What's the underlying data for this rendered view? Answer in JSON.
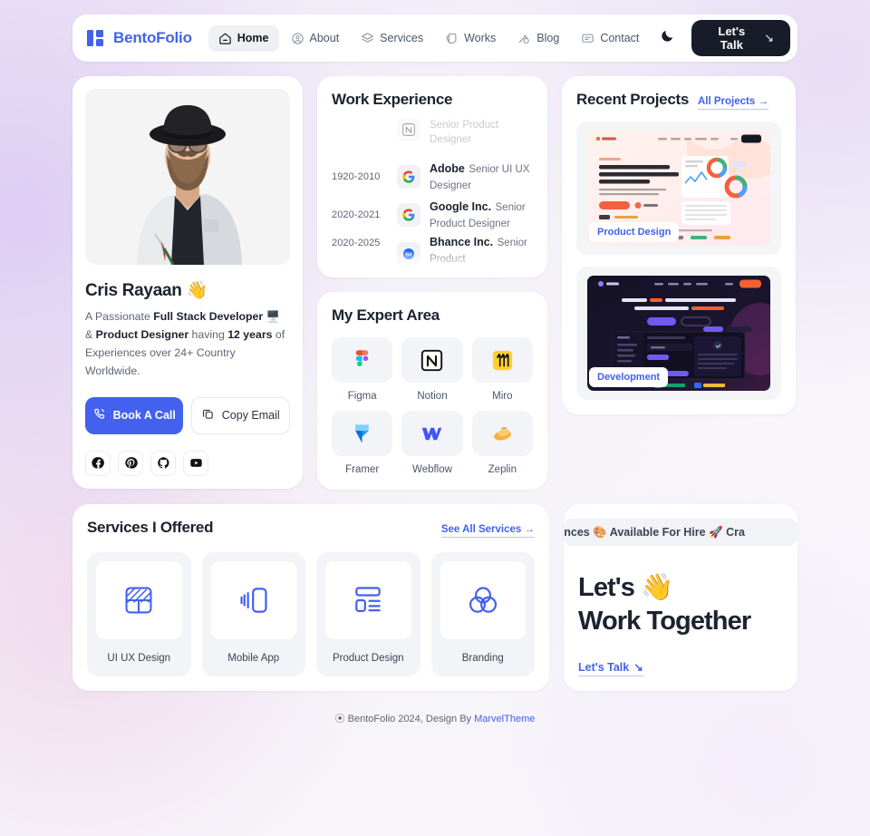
{
  "brand": {
    "name": "BentoFolio",
    "logo_icon": "bento-squares-logo",
    "color": "#4361ee"
  },
  "nav": {
    "items": [
      {
        "label": "Home",
        "icon": "home-icon",
        "active": true
      },
      {
        "label": "About",
        "icon": "user-circle-icon",
        "active": false
      },
      {
        "label": "Services",
        "icon": "layers-icon",
        "active": false
      },
      {
        "label": "Works",
        "icon": "cards-icon",
        "active": false
      },
      {
        "label": "Blog",
        "icon": "pen-icon",
        "active": false
      },
      {
        "label": "Contact",
        "icon": "message-icon",
        "active": false
      }
    ],
    "theme_toggle_icon": "moon-icon",
    "cta_label": "Let's Talk",
    "cta_arrow": "↘"
  },
  "profile": {
    "photo_alt": "portrait-photo",
    "name": "Cris Rayaan",
    "name_emoji": "👋",
    "bio_parts": [
      {
        "text": "A Passionate ",
        "bold": false
      },
      {
        "text": "Full Stack Developer",
        "bold": true
      },
      {
        "text": " 🖥️ & ",
        "bold": false
      },
      {
        "text": "Product Designer",
        "bold": true
      },
      {
        "text": " having ",
        "bold": false
      },
      {
        "text": "12 years",
        "bold": true
      },
      {
        "text": " of Experiences over 24+ Country Worldwide.",
        "bold": false
      }
    ],
    "primary_button": {
      "label": "Book A Call",
      "icon": "phone-ring-icon",
      "color": "#4361ee"
    },
    "secondary_button": {
      "label": "Copy Email",
      "icon": "copy-icon"
    },
    "socials": [
      {
        "name": "facebook-icon"
      },
      {
        "name": "pinterest-icon"
      },
      {
        "name": "github-icon"
      },
      {
        "name": "youtube-icon"
      }
    ]
  },
  "work_experience": {
    "title": "Work Experience",
    "rows": [
      {
        "year": "",
        "logo": "notion-icon",
        "company": "",
        "role": "Senior Product Designer",
        "faded": true
      },
      {
        "year": "1920-2010",
        "logo": "google-icon",
        "company": "Adobe",
        "role": "Senior UI UX Designer",
        "faded": false
      },
      {
        "year": "2020-2021",
        "logo": "google-icon",
        "company": "Google Inc.",
        "role": "Senior Product Designer",
        "faded": false
      },
      {
        "year": "2020-2025",
        "logo": "behance-icon",
        "company": "Bhance Inc.",
        "role": "Senior Product",
        "faded": false
      }
    ]
  },
  "expert_area": {
    "title": "My Expert Area",
    "items": [
      {
        "label": "Figma",
        "icon": "figma-icon"
      },
      {
        "label": "Notion",
        "icon": "notion-icon"
      },
      {
        "label": "Miro",
        "icon": "miro-icon"
      },
      {
        "label": "Framer",
        "icon": "framer-icon"
      },
      {
        "label": "Webflow",
        "icon": "webflow-icon"
      },
      {
        "label": "Zeplin",
        "icon": "zeplin-icon"
      }
    ]
  },
  "recent_projects": {
    "title": "Recent Projects",
    "link_label": "All Projects",
    "link_arrow": "→",
    "projects": [
      {
        "badge": "Product Design",
        "theme": "light",
        "preview_headline": "Your Ultimate 🎯 Email Marketing & Automation Solution Is Here",
        "preview_brand": "Mailchimp"
      },
      {
        "badge": "Development",
        "theme": "dark",
        "preview_headline": "Unlock 10X Faster & More Responsive AI-Powered Copywriting Tool",
        "preview_brand": "AIWriter"
      }
    ]
  },
  "services": {
    "title": "Services I Offered",
    "link_label": "See All Services",
    "link_arrow": "→",
    "items": [
      {
        "label": "UI UX Design",
        "icon": "frame-diagonal-icon"
      },
      {
        "label": "Mobile App",
        "icon": "mobile-swipe-icon"
      },
      {
        "label": "Product Design",
        "icon": "layout-blocks-icon"
      },
      {
        "label": "Branding",
        "icon": "venn-circles-icon"
      }
    ]
  },
  "work_together": {
    "ticker_text": "eriences 🎨 Available For Hire 🚀 Cra",
    "heading_line1": "Let's",
    "heading_emoji": "👋",
    "heading_line2": "Work Together",
    "link_label": "Let's Talk",
    "link_arrow": "↘"
  },
  "footer": {
    "text": "⦿ BentoFolio 2024, Design By ",
    "link_label": "MarvelTheme"
  }
}
